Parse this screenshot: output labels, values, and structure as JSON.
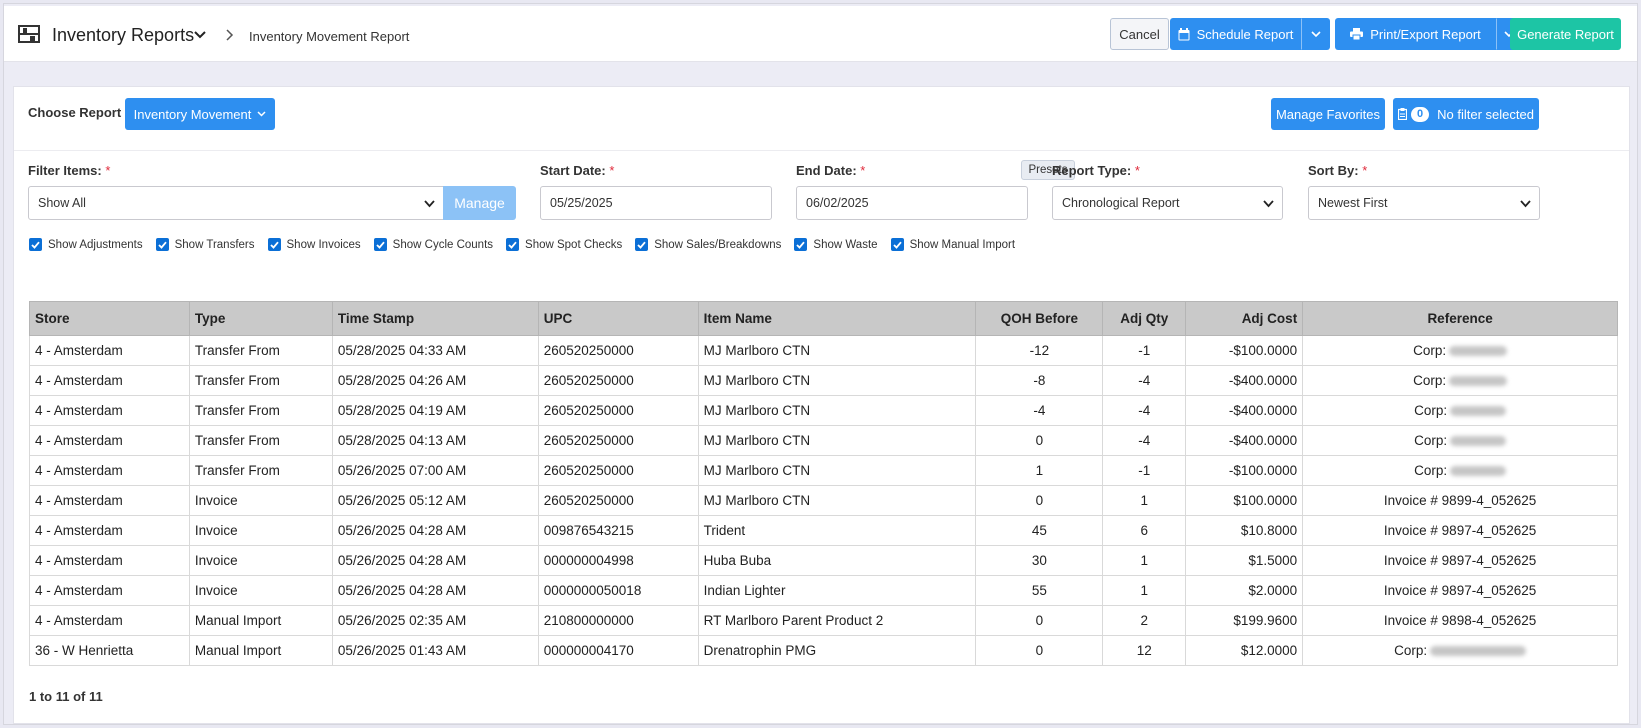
{
  "header": {
    "title": "Inventory Reports",
    "breadcrumb": "Inventory Movement Report",
    "cancel_label": "Cancel",
    "schedule_label": "Schedule Report",
    "print_label": "Print/Export Report",
    "generate_label": "Generate Report"
  },
  "choose_report": {
    "label": "Choose Report",
    "selected": "Inventory Movement",
    "manage_favorites_label": "Manage Favorites",
    "filter_count": "0",
    "filter_status": "No filter selected"
  },
  "filters": {
    "filter_items": {
      "label": "Filter Items:",
      "value": "Show All",
      "manage_label": "Manage"
    },
    "start_date": {
      "label": "Start Date:",
      "value": "05/25/2025"
    },
    "end_date": {
      "label": "End Date:",
      "value": "06/02/2025",
      "presets_label": "Presets"
    },
    "report_type": {
      "label": "Report Type:",
      "value": "Chronological Report"
    },
    "sort_by": {
      "label": "Sort By:",
      "value": "Newest First"
    },
    "required_mark": "*"
  },
  "checkboxes": [
    {
      "label": "Show Adjustments",
      "checked": true
    },
    {
      "label": "Show Transfers",
      "checked": true
    },
    {
      "label": "Show Invoices",
      "checked": true
    },
    {
      "label": "Show Cycle Counts",
      "checked": true
    },
    {
      "label": "Show Spot Checks",
      "checked": true
    },
    {
      "label": "Show Sales/Breakdowns",
      "checked": true
    },
    {
      "label": "Show Waste",
      "checked": true
    },
    {
      "label": "Show Manual Import",
      "checked": true
    }
  ],
  "table": {
    "columns": [
      "Store",
      "Type",
      "Time Stamp",
      "UPC",
      "Item Name",
      "QOH Before",
      "Adj Qty",
      "Adj Cost",
      "Reference"
    ],
    "rows": [
      {
        "store": "4 - Amsterdam",
        "type": "Transfer From",
        "time": "05/28/2025 04:33 AM",
        "upc": "260520250000",
        "item": "MJ Marlboro CTN",
        "qoh": "-12",
        "adj_qty": "-1",
        "adj_cost": "-$100.0000",
        "reference": "Corp:",
        "redacted": true
      },
      {
        "store": "4 - Amsterdam",
        "type": "Transfer From",
        "time": "05/28/2025 04:26 AM",
        "upc": "260520250000",
        "item": "MJ Marlboro CTN",
        "qoh": "-8",
        "adj_qty": "-4",
        "adj_cost": "-$400.0000",
        "reference": "Corp:",
        "redacted": true
      },
      {
        "store": "4 - Amsterdam",
        "type": "Transfer From",
        "time": "05/28/2025 04:19 AM",
        "upc": "260520250000",
        "item": "MJ Marlboro CTN",
        "qoh": "-4",
        "adj_qty": "-4",
        "adj_cost": "-$400.0000",
        "reference": "Corp:",
        "redacted": true
      },
      {
        "store": "4 - Amsterdam",
        "type": "Transfer From",
        "time": "05/28/2025 04:13 AM",
        "upc": "260520250000",
        "item": "MJ Marlboro CTN",
        "qoh": "0",
        "adj_qty": "-4",
        "adj_cost": "-$400.0000",
        "reference": "Corp:",
        "redacted": true
      },
      {
        "store": "4 - Amsterdam",
        "type": "Transfer From",
        "time": "05/26/2025 07:00 AM",
        "upc": "260520250000",
        "item": "MJ Marlboro CTN",
        "qoh": "1",
        "adj_qty": "-1",
        "adj_cost": "-$100.0000",
        "reference": "Corp:",
        "redacted": true
      },
      {
        "store": "4 - Amsterdam",
        "type": "Invoice",
        "time": "05/26/2025 05:12 AM",
        "upc": "260520250000",
        "item": "MJ Marlboro CTN",
        "qoh": "0",
        "adj_qty": "1",
        "adj_cost": "$100.0000",
        "reference": "Invoice # 9899-4_052625",
        "redacted": false
      },
      {
        "store": "4 - Amsterdam",
        "type": "Invoice",
        "time": "05/26/2025 04:28 AM",
        "upc": "009876543215",
        "item": "Trident",
        "qoh": "45",
        "adj_qty": "6",
        "adj_cost": "$10.8000",
        "reference": "Invoice # 9897-4_052625",
        "redacted": false
      },
      {
        "store": "4 - Amsterdam",
        "type": "Invoice",
        "time": "05/26/2025 04:28 AM",
        "upc": "000000004998",
        "item": "Huba Buba",
        "qoh": "30",
        "adj_qty": "1",
        "adj_cost": "$1.5000",
        "reference": "Invoice # 9897-4_052625",
        "redacted": false
      },
      {
        "store": "4 - Amsterdam",
        "type": "Invoice",
        "time": "05/26/2025 04:28 AM",
        "upc": "0000000050018",
        "item": "Indian Lighter",
        "qoh": "55",
        "adj_qty": "1",
        "adj_cost": "$2.0000",
        "reference": "Invoice # 9897-4_052625",
        "redacted": false
      },
      {
        "store": "4 - Amsterdam",
        "type": "Manual Import",
        "time": "05/26/2025 02:35 AM",
        "upc": "210800000000",
        "item": "RT Marlboro Parent Product 2",
        "qoh": "0",
        "adj_qty": "2",
        "adj_cost": "$199.9600",
        "reference": "Invoice # 9898-4_052625",
        "redacted": false
      },
      {
        "store": "36 - W Henrietta",
        "type": "Manual Import",
        "time": "05/26/2025 01:43 AM",
        "upc": "000000004170",
        "item": "Drenatrophin PMG",
        "qoh": "0",
        "adj_qty": "12",
        "adj_cost": "$12.0000",
        "reference": "Corp:",
        "redacted": true
      }
    ]
  },
  "pager": {
    "text": "1 to 11 of 11"
  },
  "colors": {
    "primary": "#2e8ff0",
    "teal": "#1dc5a5",
    "required": "#e0293a",
    "header_bg": "#c9c9c9"
  },
  "icons": {
    "app": "inventory-shelf-icon",
    "schedule": "calendar-icon",
    "print": "printer-icon",
    "filter": "clipboard-icon"
  }
}
